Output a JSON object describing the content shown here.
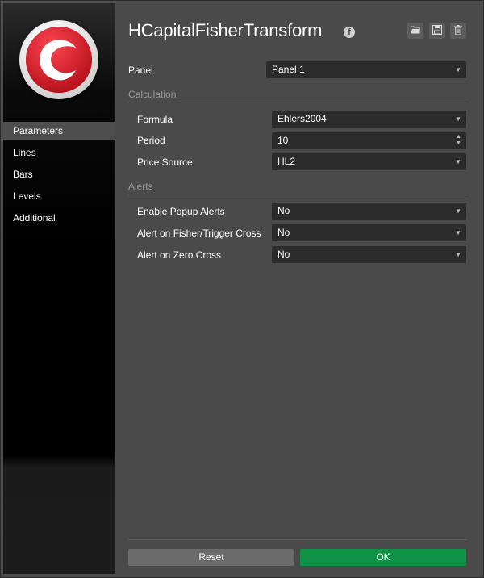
{
  "title": "HCapitalFisherTransform",
  "sidebar": {
    "items": [
      {
        "label": "Parameters",
        "active": true
      },
      {
        "label": "Lines"
      },
      {
        "label": "Bars"
      },
      {
        "label": "Levels"
      },
      {
        "label": "Additional"
      }
    ]
  },
  "panel": {
    "label": "Panel",
    "value": "Panel 1"
  },
  "calculation": {
    "heading": "Calculation",
    "formula": {
      "label": "Formula",
      "value": "Ehlers2004"
    },
    "period": {
      "label": "Period",
      "value": "10"
    },
    "price_source": {
      "label": "Price Source",
      "value": "HL2"
    }
  },
  "alerts": {
    "heading": "Alerts",
    "popup": {
      "label": "Enable Popup Alerts",
      "value": "No"
    },
    "fisher_cross": {
      "label": "Alert on Fisher/Trigger Cross",
      "value": "No"
    },
    "zero_cross": {
      "label": "Alert on Zero Cross",
      "value": "No"
    }
  },
  "buttons": {
    "reset": "Reset",
    "ok": "OK"
  },
  "icons": {
    "facebook": "facebook-icon",
    "open": "folder-open-icon",
    "save": "save-icon",
    "delete": "trash-icon",
    "dropdown": "chevron-down-icon"
  },
  "colors": {
    "ok": "#0f9245",
    "logo_red": "#e11d2a"
  }
}
